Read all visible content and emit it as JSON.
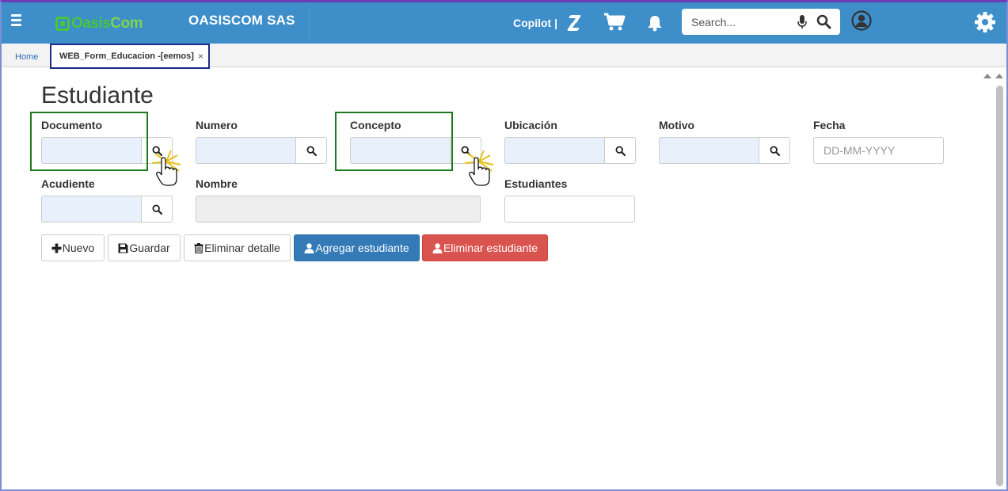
{
  "navbar": {
    "logo_oasis": "Oasis",
    "logo_com": "Com",
    "company": "OASISCOM SAS",
    "copilot_label": "Copilot |",
    "search_placeholder": "Search..."
  },
  "tabs": {
    "home": "Home",
    "active": "WEB_Form_Educacion -[eemos]",
    "close": "×"
  },
  "form": {
    "title": "Estudiante",
    "fields": {
      "documento": {
        "label": "Documento",
        "value": ""
      },
      "numero": {
        "label": "Numero",
        "value": ""
      },
      "concepto": {
        "label": "Concepto",
        "value": ""
      },
      "ubicacion": {
        "label": "Ubicación",
        "value": ""
      },
      "motivo": {
        "label": "Motivo",
        "value": ""
      },
      "fecha": {
        "label": "Fecha",
        "placeholder": "DD-MM-YYYY",
        "value": ""
      },
      "acudiente": {
        "label": "Acudiente",
        "value": ""
      },
      "nombre": {
        "label": "Nombre",
        "value": ""
      },
      "estudiantes": {
        "label": "Estudiantes",
        "value": ""
      }
    },
    "buttons": {
      "nuevo": "Nuevo",
      "guardar": "Guardar",
      "eliminar_detalle": "Eliminar detalle",
      "agregar_estudiante": "Agregar estudiante",
      "eliminar_estudiante": "Eliminar estudiante"
    }
  },
  "colors": {
    "navbar": "#3d8ec9",
    "highlight": "#1f7a1f",
    "primary": "#337ab7",
    "danger": "#d9534f"
  },
  "icons": [
    "menu-icon",
    "copilot-icon",
    "cart-icon",
    "bell-icon",
    "microphone-icon",
    "search-icon",
    "user-icon",
    "gear-icon",
    "plus-icon",
    "save-icon",
    "trash-icon",
    "user-add-icon",
    "user-remove-icon",
    "pointer-hand-icon"
  ]
}
